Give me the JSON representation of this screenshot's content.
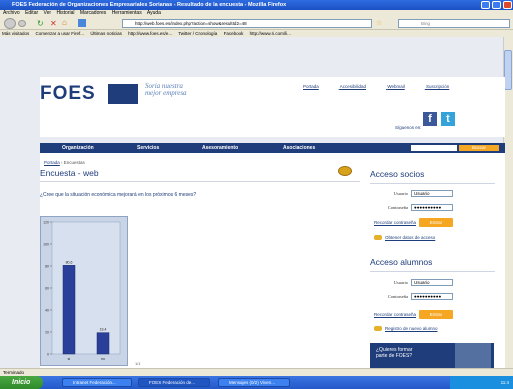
{
  "window": {
    "title": "FOES Federación de Organizaciones Empresariales Sorianas - Resultado de la encuesta - Mozilla Firefox"
  },
  "menu": [
    "Archivo",
    "Editar",
    "Ver",
    "Historial",
    "Marcadores",
    "Herramientas",
    "Ayuda"
  ],
  "url": "http://web.foes.es/index.php?action=show&resultId2=48",
  "browser_search": {
    "placeholder": "Bing"
  },
  "bookmarks": [
    "Más visitados",
    "Comenzar a usar Firef...",
    "Últimas noticias",
    "http://www.foes.es/e...",
    "Twitter / Cronología",
    "Facebook",
    "http://www.ri.com/li..."
  ],
  "site": {
    "logo": "FOES",
    "slogan_line1": "Soria nuestra",
    "slogan_line2": "mejor empresa",
    "toplinks": [
      "Portada",
      "Accesibilidad",
      "Webmail",
      "Suscripción"
    ],
    "siguenos": "Síguenos en:",
    "nav": [
      "Organización",
      "Servicios",
      "Asesoramiento",
      "Asociaciones"
    ],
    "nav_search_button": "Buscar"
  },
  "breadcrumb": {
    "home": "Portada",
    "current": "Encuestas"
  },
  "survey": {
    "title": "Encuesta - web",
    "question": "¿Cree que la situación económica mejorará en los próximos 6 meses?"
  },
  "chart_data": {
    "type": "bar",
    "categories": [
      "sí",
      "no"
    ],
    "values": [
      80.6,
      19.4
    ],
    "data_labels": [
      "80,6",
      "19,4"
    ],
    "yticks": [
      "0",
      "20",
      "40",
      "60",
      "80",
      "100",
      "120"
    ],
    "ylim": [
      0,
      120
    ],
    "colors": [
      "#2a3f9a"
    ]
  },
  "page_number": "1/1",
  "login": {
    "title": "Acceso socios",
    "user_label": "Usuario",
    "user_value": "Usuario",
    "pass_label": "Contraseña",
    "pass_value": "●●●●●●●●●●",
    "recover": "Recordar contraseña",
    "button": "Entrar",
    "link": "Obtener datos de acceso"
  },
  "alumni": {
    "title": "Acceso alumnos",
    "user_label": "Usuario",
    "user_value": "Usuario",
    "pass_label": "Contraseña",
    "pass_value": "●●●●●●●●●●",
    "recover": "Recordar contraseña",
    "button": "Entrar",
    "link": "Registro de nuevo alumno"
  },
  "banner": {
    "line1": "¿Quieres formar",
    "line2": "parte de FOES?"
  },
  "status": "Terminado",
  "taskbar": {
    "start": "Inicio",
    "tasks": [
      "Intranet Federación...",
      "FOES Federación de...",
      "Mensajes (0/2) Viven..."
    ],
    "clock": "11:4"
  }
}
